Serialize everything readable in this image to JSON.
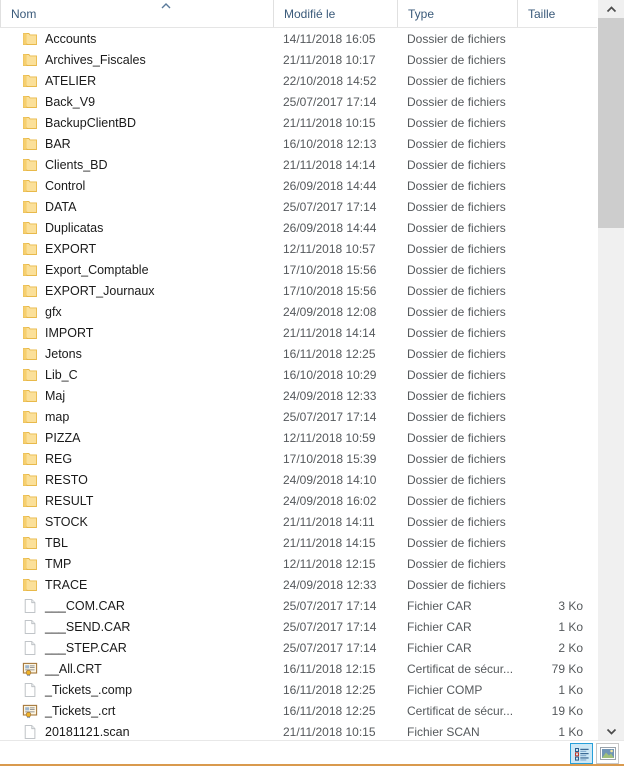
{
  "window": {
    "view_mode": "details",
    "language": "fr"
  },
  "columns": [
    {
      "key": "name",
      "label": "Nom",
      "sorted": true,
      "sort_direction": "asc"
    },
    {
      "key": "modified",
      "label": "Modifié le",
      "sorted": false,
      "sort_direction": ""
    },
    {
      "key": "type",
      "label": "Type",
      "sorted": false,
      "sort_direction": ""
    },
    {
      "key": "size",
      "label": "Taille",
      "sorted": false,
      "sort_direction": ""
    }
  ],
  "rows": [
    {
      "name": "Accounts",
      "modified": "14/11/2018 16:05",
      "type": "Dossier de fichiers",
      "size": "",
      "icon": "folder-icon"
    },
    {
      "name": "Archives_Fiscales",
      "modified": "21/11/2018 10:17",
      "type": "Dossier de fichiers",
      "size": "",
      "icon": "folder-icon"
    },
    {
      "name": "ATELIER",
      "modified": "22/10/2018 14:52",
      "type": "Dossier de fichiers",
      "size": "",
      "icon": "folder-icon"
    },
    {
      "name": "Back_V9",
      "modified": "25/07/2017 17:14",
      "type": "Dossier de fichiers",
      "size": "",
      "icon": "folder-icon"
    },
    {
      "name": "BackupClientBD",
      "modified": "21/11/2018 10:15",
      "type": "Dossier de fichiers",
      "size": "",
      "icon": "folder-icon"
    },
    {
      "name": "BAR",
      "modified": "16/10/2018 12:13",
      "type": "Dossier de fichiers",
      "size": "",
      "icon": "folder-icon"
    },
    {
      "name": "Clients_BD",
      "modified": "21/11/2018 14:14",
      "type": "Dossier de fichiers",
      "size": "",
      "icon": "folder-icon"
    },
    {
      "name": "Control",
      "modified": "26/09/2018 14:44",
      "type": "Dossier de fichiers",
      "size": "",
      "icon": "folder-icon"
    },
    {
      "name": "DATA",
      "modified": "25/07/2017 17:14",
      "type": "Dossier de fichiers",
      "size": "",
      "icon": "folder-icon"
    },
    {
      "name": "Duplicatas",
      "modified": "26/09/2018 14:44",
      "type": "Dossier de fichiers",
      "size": "",
      "icon": "folder-icon"
    },
    {
      "name": "EXPORT",
      "modified": "12/11/2018 10:57",
      "type": "Dossier de fichiers",
      "size": "",
      "icon": "folder-icon"
    },
    {
      "name": "Export_Comptable",
      "modified": "17/10/2018 15:56",
      "type": "Dossier de fichiers",
      "size": "",
      "icon": "folder-icon"
    },
    {
      "name": "EXPORT_Journaux",
      "modified": "17/10/2018 15:56",
      "type": "Dossier de fichiers",
      "size": "",
      "icon": "folder-icon"
    },
    {
      "name": "gfx",
      "modified": "24/09/2018 12:08",
      "type": "Dossier de fichiers",
      "size": "",
      "icon": "folder-icon"
    },
    {
      "name": "IMPORT",
      "modified": "21/11/2018 14:14",
      "type": "Dossier de fichiers",
      "size": "",
      "icon": "folder-icon"
    },
    {
      "name": "Jetons",
      "modified": "16/11/2018 12:25",
      "type": "Dossier de fichiers",
      "size": "",
      "icon": "folder-icon"
    },
    {
      "name": "Lib_C",
      "modified": "16/10/2018 10:29",
      "type": "Dossier de fichiers",
      "size": "",
      "icon": "folder-icon"
    },
    {
      "name": "Maj",
      "modified": "24/09/2018 12:33",
      "type": "Dossier de fichiers",
      "size": "",
      "icon": "folder-icon"
    },
    {
      "name": "map",
      "modified": "25/07/2017 17:14",
      "type": "Dossier de fichiers",
      "size": "",
      "icon": "folder-icon"
    },
    {
      "name": "PIZZA",
      "modified": "12/11/2018 10:59",
      "type": "Dossier de fichiers",
      "size": "",
      "icon": "folder-icon"
    },
    {
      "name": "REG",
      "modified": "17/10/2018 15:39",
      "type": "Dossier de fichiers",
      "size": "",
      "icon": "folder-icon"
    },
    {
      "name": "RESTO",
      "modified": "24/09/2018 14:10",
      "type": "Dossier de fichiers",
      "size": "",
      "icon": "folder-icon"
    },
    {
      "name": "RESULT",
      "modified": "24/09/2018 16:02",
      "type": "Dossier de fichiers",
      "size": "",
      "icon": "folder-icon"
    },
    {
      "name": "STOCK",
      "modified": "21/11/2018 14:11",
      "type": "Dossier de fichiers",
      "size": "",
      "icon": "folder-icon"
    },
    {
      "name": "TBL",
      "modified": "21/11/2018 14:15",
      "type": "Dossier de fichiers",
      "size": "",
      "icon": "folder-icon"
    },
    {
      "name": "TMP",
      "modified": "12/11/2018 12:15",
      "type": "Dossier de fichiers",
      "size": "",
      "icon": "folder-icon"
    },
    {
      "name": "TRACE",
      "modified": "24/09/2018 12:33",
      "type": "Dossier de fichiers",
      "size": "",
      "icon": "folder-icon"
    },
    {
      "name": "___COM.CAR",
      "modified": "25/07/2017 17:14",
      "type": "Fichier CAR",
      "size": "3 Ko",
      "icon": "blank-document-icon"
    },
    {
      "name": "___SEND.CAR",
      "modified": "25/07/2017 17:14",
      "type": "Fichier CAR",
      "size": "1 Ko",
      "icon": "blank-document-icon"
    },
    {
      "name": "___STEP.CAR",
      "modified": "25/07/2017 17:14",
      "type": "Fichier CAR",
      "size": "2 Ko",
      "icon": "blank-document-icon"
    },
    {
      "name": "__All.CRT",
      "modified": "16/11/2018 12:15",
      "type": "Certificat de sécur...",
      "size": "79 Ko",
      "icon": "certificate-icon"
    },
    {
      "name": "_Tickets_.comp",
      "modified": "16/11/2018 12:25",
      "type": "Fichier COMP",
      "size": "1 Ko",
      "icon": "blank-document-icon"
    },
    {
      "name": "_Tickets_.crt",
      "modified": "16/11/2018 12:25",
      "type": "Certificat de sécur...",
      "size": "19 Ko",
      "icon": "certificate-icon"
    },
    {
      "name": "20181121.scan",
      "modified": "21/11/2018 10:15",
      "type": "Fichier SCAN",
      "size": "1 Ko",
      "icon": "blank-document-icon"
    }
  ],
  "view_buttons": [
    {
      "name": "details-view",
      "icon": "details-view-icon",
      "active": true
    },
    {
      "name": "large-icons-view",
      "icon": "large-icons-view-icon",
      "active": false
    }
  ],
  "colors": {
    "folder": "#f7d277",
    "folder_edge": "#e8b94a",
    "header_text": "#3a5a7a",
    "row_text": "#1a1a1a",
    "meta_text": "#55595c",
    "selection_blue": "#26a0da",
    "selection_fill": "#cde8f6",
    "scrollbar_track": "#f0f0f0",
    "scrollbar_thumb": "#cdcdcd",
    "bottom_accent": "#d99a4e"
  }
}
